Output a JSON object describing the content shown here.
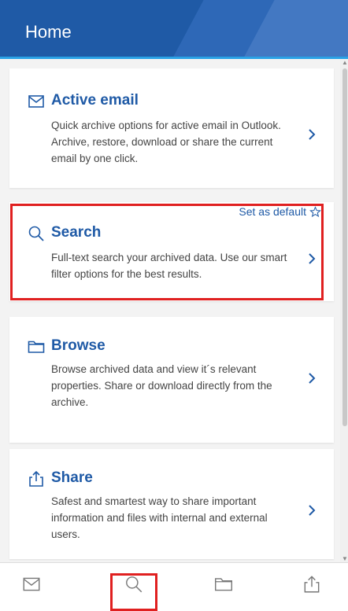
{
  "header": {
    "title": "Home"
  },
  "cards": [
    {
      "title": "Active email",
      "description": "Quick archive options for active email in Outlook. Archive, restore, download or share the current email by one click."
    },
    {
      "title": "Search",
      "description": "Full-text search your archived data. Use our smart filter options for the best results.",
      "action": "Set as default"
    },
    {
      "title": "Browse",
      "description": "Browse archived data and view it´s relevant properties. Share or download directly from the archive."
    },
    {
      "title": "Share",
      "description": "Safest and smartest way to share important information and files with internal and external users."
    }
  ],
  "icons": {
    "email": "envelope-icon",
    "search": "magnifier-icon",
    "browse": "folder-icon",
    "share": "share-icon",
    "chevron": "chevron-right-icon",
    "star": "star-outline-icon"
  },
  "colors": {
    "header": "#1f5aa6",
    "accent": "#2aa2e6",
    "highlight": "#e02020"
  },
  "bottom_nav": {
    "active": "search"
  }
}
